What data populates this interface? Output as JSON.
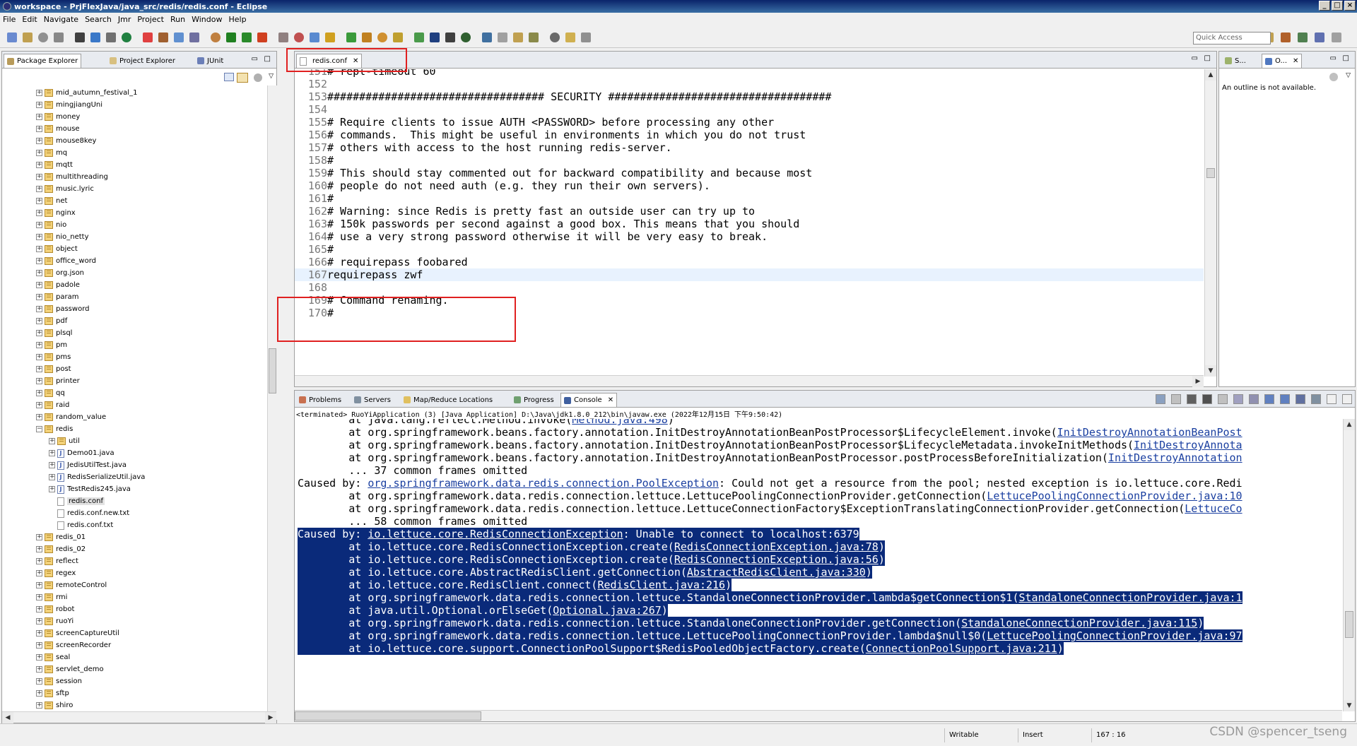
{
  "window": {
    "title": "workspace - PrjFlexJava/java_src/redis/redis.conf - Eclipse"
  },
  "menu": [
    "File",
    "Edit",
    "Navigate",
    "Search",
    "Jmr",
    "Project",
    "Run",
    "Window",
    "Help"
  ],
  "toolbar": {
    "quick_access_placeholder": "Quick Access"
  },
  "left_panel": {
    "tabs": [
      "Package Explorer",
      "Project Explorer",
      "JUnit"
    ],
    "tree": [
      {
        "label": "mid_autumn_festival_1",
        "kind": "pkg"
      },
      {
        "label": "mingjiangUni",
        "kind": "pkg"
      },
      {
        "label": "money",
        "kind": "pkg"
      },
      {
        "label": "mouse",
        "kind": "pkg"
      },
      {
        "label": "mouse8key",
        "kind": "pkg"
      },
      {
        "label": "mq",
        "kind": "pkg"
      },
      {
        "label": "mqtt",
        "kind": "pkg"
      },
      {
        "label": "multithreading",
        "kind": "pkg"
      },
      {
        "label": "music.lyric",
        "kind": "pkg"
      },
      {
        "label": "net",
        "kind": "pkg"
      },
      {
        "label": "nginx",
        "kind": "pkg"
      },
      {
        "label": "nio",
        "kind": "pkg"
      },
      {
        "label": "nio_netty",
        "kind": "pkg"
      },
      {
        "label": "object",
        "kind": "pkg"
      },
      {
        "label": "office_word",
        "kind": "pkg"
      },
      {
        "label": "org.json",
        "kind": "pkg"
      },
      {
        "label": "padole",
        "kind": "pkg"
      },
      {
        "label": "param",
        "kind": "pkg"
      },
      {
        "label": "password",
        "kind": "pkg"
      },
      {
        "label": "pdf",
        "kind": "pkg"
      },
      {
        "label": "plsql",
        "kind": "pkg"
      },
      {
        "label": "pm",
        "kind": "pkg"
      },
      {
        "label": "pms",
        "kind": "pkg"
      },
      {
        "label": "post",
        "kind": "pkg"
      },
      {
        "label": "printer",
        "kind": "pkg"
      },
      {
        "label": "qq",
        "kind": "pkg"
      },
      {
        "label": "raid",
        "kind": "pkg"
      },
      {
        "label": "random_value",
        "kind": "pkg"
      },
      {
        "label": "redis",
        "kind": "pkg-open"
      },
      {
        "label": "util",
        "kind": "sub-pkg"
      },
      {
        "label": "Demo01.java",
        "kind": "java"
      },
      {
        "label": "JedisUtilTest.java",
        "kind": "java"
      },
      {
        "label": "RedisSerializeUtil.java",
        "kind": "java"
      },
      {
        "label": "TestRedis245.java",
        "kind": "java"
      },
      {
        "label": "redis.conf",
        "kind": "file-selected"
      },
      {
        "label": "redis.conf.new.txt",
        "kind": "file"
      },
      {
        "label": "redis.conf.txt",
        "kind": "file"
      },
      {
        "label": "redis_01",
        "kind": "pkg"
      },
      {
        "label": "redis_02",
        "kind": "pkg"
      },
      {
        "label": "reflect",
        "kind": "pkg"
      },
      {
        "label": "regex",
        "kind": "pkg"
      },
      {
        "label": "remoteControl",
        "kind": "pkg"
      },
      {
        "label": "rmi",
        "kind": "pkg"
      },
      {
        "label": "robot",
        "kind": "pkg"
      },
      {
        "label": "ruoYi",
        "kind": "pkg"
      },
      {
        "label": "screenCaptureUtil",
        "kind": "pkg"
      },
      {
        "label": "screenRecorder",
        "kind": "pkg"
      },
      {
        "label": "seal",
        "kind": "pkg"
      },
      {
        "label": "servlet_demo",
        "kind": "pkg"
      },
      {
        "label": "session",
        "kind": "pkg"
      },
      {
        "label": "sftp",
        "kind": "pkg"
      },
      {
        "label": "shiro",
        "kind": "pkg"
      }
    ]
  },
  "editor": {
    "tab_label": "redis.conf",
    "lines": [
      {
        "n": "151",
        "text": "# repl-timeout 60"
      },
      {
        "n": "152",
        "text": ""
      },
      {
        "n": "153",
        "text": "################################## SECURITY ###################################"
      },
      {
        "n": "154",
        "text": ""
      },
      {
        "n": "155",
        "text": "# Require clients to issue AUTH <PASSWORD> before processing any other"
      },
      {
        "n": "156",
        "text": "# commands.  This might be useful in environments in which you do not trust"
      },
      {
        "n": "157",
        "text": "# others with access to the host running redis-server."
      },
      {
        "n": "158",
        "text": "#"
      },
      {
        "n": "159",
        "text": "# This should stay commented out for backward compatibility and because most"
      },
      {
        "n": "160",
        "text": "# people do not need auth (e.g. they run their own servers)."
      },
      {
        "n": "161",
        "text": "#"
      },
      {
        "n": "162",
        "text": "# Warning: since Redis is pretty fast an outside user can try up to"
      },
      {
        "n": "163",
        "text": "# 150k passwords per second against a good box. This means that you should"
      },
      {
        "n": "164",
        "text": "# use a very strong password otherwise it will be very easy to break."
      },
      {
        "n": "165",
        "text": "#"
      },
      {
        "n": "166",
        "text": "# requirepass foobared"
      },
      {
        "n": "167",
        "text": "requirepass zwf"
      },
      {
        "n": "168",
        "text": ""
      },
      {
        "n": "169",
        "text": "# Command renaming."
      },
      {
        "n": "170",
        "text": "#"
      }
    ]
  },
  "outline_panel": {
    "tabs": [
      "S...",
      "O..."
    ],
    "message": "An outline is not available."
  },
  "bottom_panel": {
    "tabs": [
      "Problems",
      "Servers",
      "Map/Reduce Locations",
      "Progress",
      "Console"
    ],
    "terminated_line": "<terminated> RuoYiApplication (3) [Java Application] D:\\Java\\jdk1.8.0_212\\bin\\javaw.exe (2022年12月15日 下午9:50:42)",
    "lines": [
      {
        "pre": "        at java.lang.reflect.Method.invoke(",
        "link": "Method.java:498",
        "post": ")",
        "hl": false
      },
      {
        "pre": "        at org.springframework.beans.factory.annotation.InitDestroyAnnotationBeanPostProcessor$LifecycleElement.invoke(",
        "link": "InitDestroyAnnotationBeanPost",
        "post": "",
        "hl": false
      },
      {
        "pre": "        at org.springframework.beans.factory.annotation.InitDestroyAnnotationBeanPostProcessor$LifecycleMetadata.invokeInitMethods(",
        "link": "InitDestroyAnnota",
        "post": "",
        "hl": false
      },
      {
        "pre": "        at org.springframework.beans.factory.annotation.InitDestroyAnnotationBeanPostProcessor.postProcessBeforeInitialization(",
        "link": "InitDestroyAnnotation",
        "post": "",
        "hl": false
      },
      {
        "pre": "        ... 37 common frames omitted",
        "link": "",
        "post": "",
        "hl": false
      },
      {
        "pre": "Caused by: ",
        "link": "org.springframework.data.redis.connection.PoolException",
        "post": ": Could not get a resource from the pool; nested exception is io.lettuce.core.Redi",
        "hl": false
      },
      {
        "pre": "        at org.springframework.data.redis.connection.lettuce.LettucePoolingConnectionProvider.getConnection(",
        "link": "LettucePoolingConnectionProvider.java:10",
        "post": "",
        "hl": false
      },
      {
        "pre": "        at org.springframework.data.redis.connection.lettuce.LettuceConnectionFactory$ExceptionTranslatingConnectionProvider.getConnection(",
        "link": "LettuceCo",
        "post": "",
        "hl": false
      },
      {
        "pre": "        ... 58 common frames omitted",
        "link": "",
        "post": "",
        "hl": false
      },
      {
        "pre": "Caused by: ",
        "link": "io.lettuce.core.RedisConnectionException",
        "post": ": Unable to connect to localhost:6379",
        "hl": true
      },
      {
        "pre": "        at io.lettuce.core.RedisConnectionException.create(",
        "link": "RedisConnectionException.java:78",
        "post": ")",
        "hl": true
      },
      {
        "pre": "        at io.lettuce.core.RedisConnectionException.create(",
        "link": "RedisConnectionException.java:56",
        "post": ")",
        "hl": true
      },
      {
        "pre": "        at io.lettuce.core.AbstractRedisClient.getConnection(",
        "link": "AbstractRedisClient.java:330",
        "post": ")",
        "hl": true
      },
      {
        "pre": "        at io.lettuce.core.RedisClient.connect(",
        "link": "RedisClient.java:216",
        "post": ")",
        "hl": true
      },
      {
        "pre": "        at org.springframework.data.redis.connection.lettuce.StandaloneConnectionProvider.lambda$getConnection$1(",
        "link": "StandaloneConnectionProvider.java:1",
        "post": "",
        "hl": true
      },
      {
        "pre": "        at java.util.Optional.orElseGet(",
        "link": "Optional.java:267",
        "post": ")",
        "hl": true
      },
      {
        "pre": "        at org.springframework.data.redis.connection.lettuce.StandaloneConnectionProvider.getConnection(",
        "link": "StandaloneConnectionProvider.java:115",
        "post": ")",
        "hl": true
      },
      {
        "pre": "        at org.springframework.data.redis.connection.lettuce.LettucePoolingConnectionProvider.lambda$null$0(",
        "link": "LettucePoolingConnectionProvider.java:97",
        "post": "",
        "hl": true
      },
      {
        "pre": "        at io.lettuce.core.support.ConnectionPoolSupport$RedisPooledObjectFactory.create(",
        "link": "ConnectionPoolSupport.java:211",
        "post": ")",
        "hl": true
      }
    ]
  },
  "status": {
    "mode": "Writable",
    "insert": "Insert",
    "position": "167 : 16"
  },
  "watermark": "CSDN @spencer_tseng"
}
